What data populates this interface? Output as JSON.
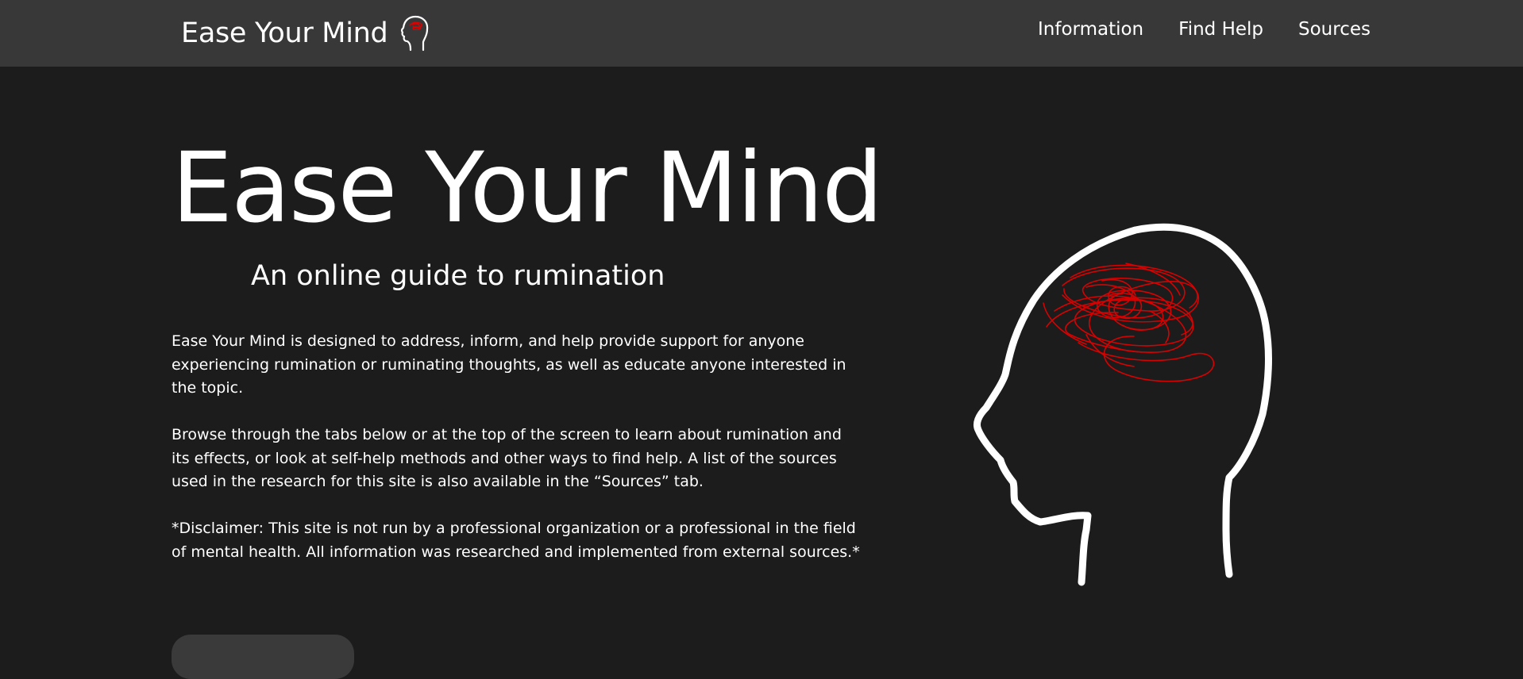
{
  "nav": {
    "brand": "Ease Your Mind",
    "links": [
      "Information",
      "Find Help",
      "Sources"
    ]
  },
  "hero": {
    "title": "Ease Your Mind",
    "subtitle": "An online guide to rumination",
    "paragraphs": [
      "Ease Your Mind is designed to address, inform, and help provide support for anyone experiencing rumination or ruminating thoughts, as well as educate anyone interested in the topic.",
      "Browse through the tabs below or at the top of the screen to learn about rumination and its effects, or look at self-help methods and other ways to find help. A list of the sources used in the research for this site is also available in the “Sources” tab.",
      "*Disclaimer: This site is not run by a professional organization or a professional in the field of mental health. All information was researched and implemented from external sources.*"
    ]
  },
  "colors": {
    "page_bg": "#1c1c1c",
    "navbar_bg": "#383838",
    "text": "#ffffff",
    "scribble": "#e00000"
  }
}
